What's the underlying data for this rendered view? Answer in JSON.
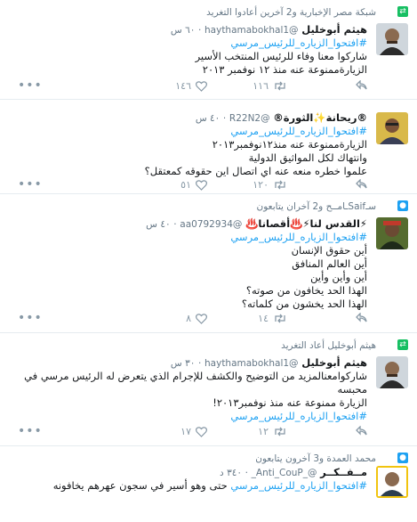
{
  "tweets": [
    {
      "context": "شبكة مصر الإخبارية و2 آخرين أعادوا التغريد",
      "context_icon": "retweet-icon",
      "name": "هيثم أبوخليل",
      "handle": "@haythamabokhal1",
      "time": "٦٠ س",
      "lines": [
        "#افتحوا_الزياره_للرئيس_مرسي",
        "شاركوا معنا وفاء للرئيس المنتخب الأسير",
        "الزيارةممنوعة عنه منذ ١٢ نوفمبر ٢٠١٣"
      ],
      "replies": "",
      "retweets": "١١٦",
      "likes": "١٤٦"
    },
    {
      "context": "",
      "name": "®ريحانة✨الثورة®",
      "handle": "@R22N2",
      "time": "٤٠ س",
      "lines": [
        "#افتحوا_الزياره_للرئيس_مرسي",
        "الزيارةممنوعة عنه منذ١٢نوفمبر٢٠١٣",
        "وانتهاك لكل المواثيق الدولية",
        "علموا خطره منعه عنه اي اتصال اين حقوقه كمعتقل؟"
      ],
      "replies": "",
      "retweets": "١٢٠",
      "likes": "٥١"
    },
    {
      "context": "سـSaifـامــح و2 آخران يتابعون",
      "context_icon": "user-icon",
      "name": "⚡القدس لنا⚡♨️أقصانا♨️",
      "handle": "@aa0792934",
      "time": "٤٠ س",
      "lines": [
        "#افتحوا_الزياره_للرئيس_مرسي",
        "أين حقوق الإنسان",
        "أين العالم المنافق",
        "أين وأين وأين",
        "الهذا الحد يخافون من صوته؟",
        "الهذا الحد يخشون من كلماته؟"
      ],
      "replies": "",
      "retweets": "١٤",
      "likes": "٨"
    },
    {
      "context": "هيثم أبوخليل أعاد التغريد",
      "context_icon": "retweet-icon",
      "name": "هيثم أبوخليل",
      "handle": "@haythamabokhal1",
      "time": "٣٠ س",
      "lines": [
        "شاركوامعنالمزيد من التوضيح والكشف للإجرام الذي يتعرض له الرئيس مرسي في محبسه",
        "الزيارة ممنوعة عنه منذ نوفمبر٢٠١٣!",
        "#افتحوا_الزياره_للرئيس_مرسي"
      ],
      "replies": "",
      "retweets": "١٢",
      "likes": "١٧"
    },
    {
      "context": "محمد العمدة و3 آخرون يتابعون",
      "context_icon": "user-icon",
      "name": "مــفــكــر",
      "handle": "@_Anti_CouP_",
      "time": "٣٤٠ د",
      "lines": [
        "#افتحوا_الزياره_للرئيس_مرسي حتى وهو أسير في سجون عهرهم يخافونه"
      ],
      "replies": "",
      "retweets": "",
      "likes": ""
    }
  ],
  "colors": {
    "link": "#1da1f2",
    "muted": "#657786",
    "retweet_green": "#17bf63"
  }
}
